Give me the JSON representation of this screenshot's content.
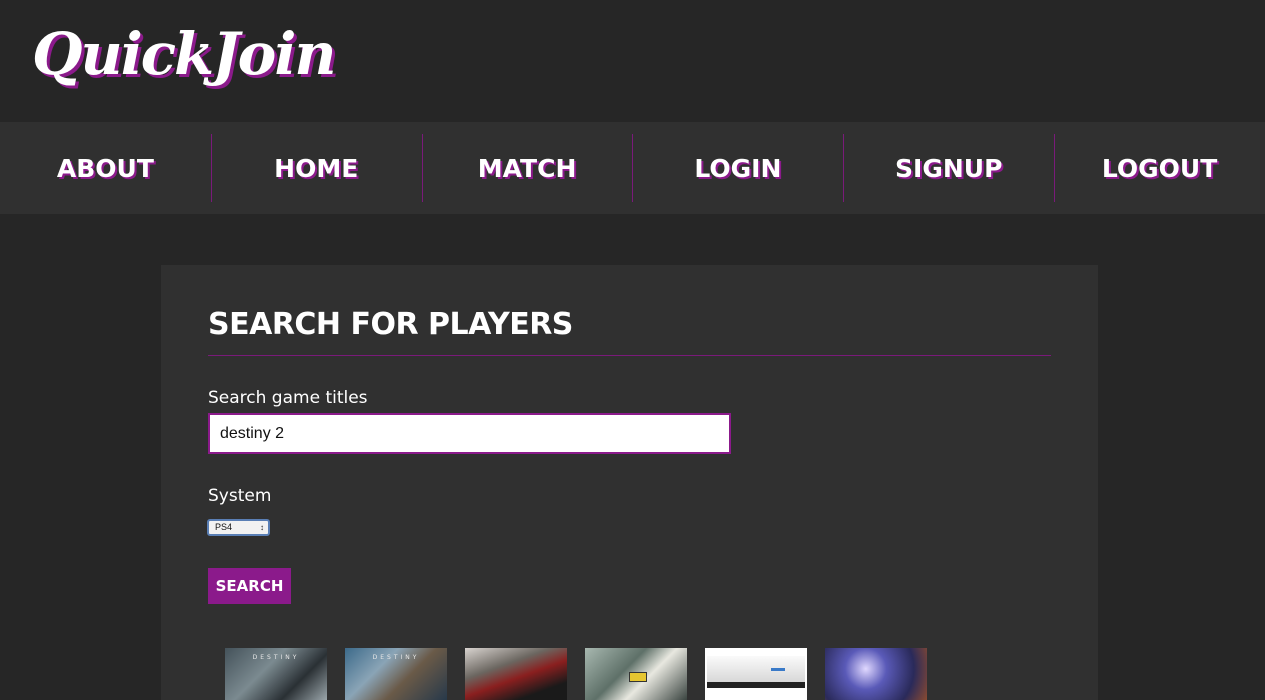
{
  "header": {
    "logo": "QuickJoin"
  },
  "nav": {
    "items": [
      {
        "label": "ABOUT"
      },
      {
        "label": "HOME"
      },
      {
        "label": "MATCH"
      },
      {
        "label": "LOGIN"
      },
      {
        "label": "SIGNUP"
      },
      {
        "label": "LOGOUT"
      }
    ]
  },
  "search": {
    "title": "SEARCH FOR PLAYERS",
    "game_label": "Search game titles",
    "game_value": "destiny 2",
    "system_label": "System",
    "system_value": "PS4",
    "button_label": "SEARCH"
  },
  "results": {
    "thumbnails": [
      {
        "icon": "game-cover-image",
        "caption": "DESTINY"
      },
      {
        "icon": "game-cover-image",
        "caption": "DESTINY"
      },
      {
        "icon": "game-cover-image",
        "caption": ""
      },
      {
        "icon": "game-cover-image",
        "caption": ""
      },
      {
        "icon": "console-image",
        "caption": ""
      },
      {
        "icon": "game-cover-image",
        "caption": ""
      }
    ]
  },
  "colors": {
    "accent": "#8b1a8b",
    "background": "#262626",
    "panel": "#303030"
  }
}
